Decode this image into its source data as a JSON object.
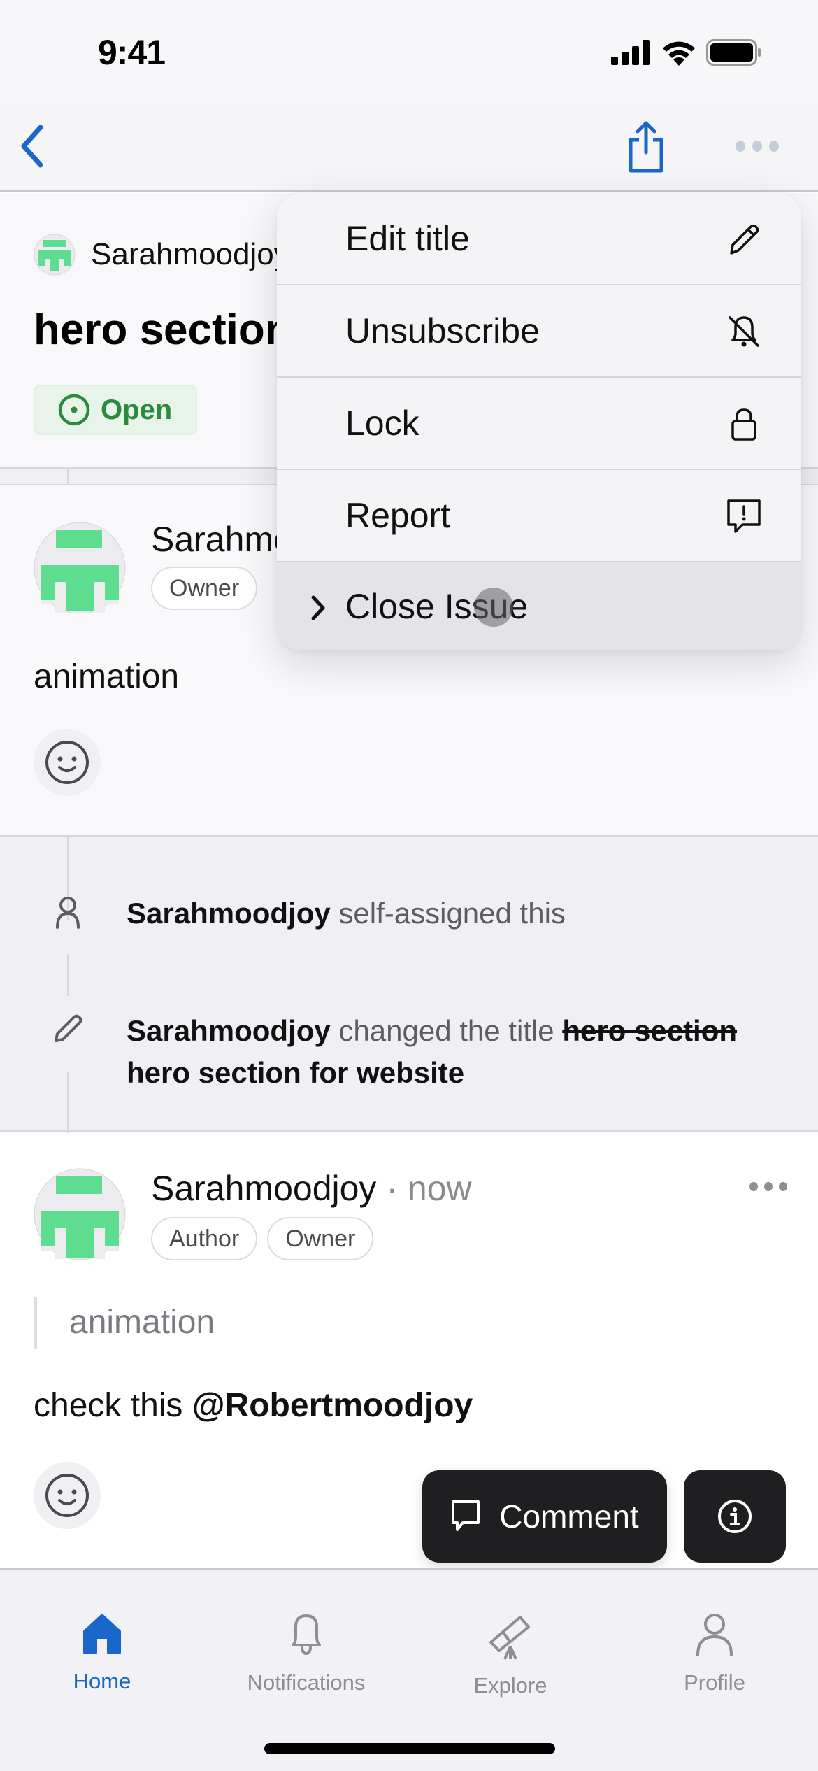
{
  "status_bar": {
    "time": "9:41"
  },
  "nav": {
    "back_icon": "chevron-left-icon",
    "share_icon": "share-icon",
    "more_icon": "ellipsis-icon",
    "accent_color": "#1a66c9"
  },
  "issue": {
    "author": "Sarahmoodjoy",
    "title": "hero section for website",
    "state": "Open",
    "state_color": "#2a8a3d"
  },
  "comments": [
    {
      "author": "Sarahmoodjoy",
      "badges": [
        "Owner"
      ],
      "body": "animation"
    },
    {
      "author": "Sarahmoodjoy",
      "separator": "·",
      "time": "now",
      "badges": [
        "Author",
        "Owner"
      ],
      "quote": "animation",
      "body_prefix": "check this ",
      "mention": "@Robertmoodjoy"
    }
  ],
  "events": [
    {
      "icon": "person-icon",
      "actor": "Sarahmoodjoy",
      "action": "self-assigned this"
    },
    {
      "icon": "pencil-icon",
      "actor": "Sarahmoodjoy",
      "action": "changed the title",
      "old_title": "hero section",
      "new_title": "hero section for website"
    }
  ],
  "menu": {
    "items": [
      {
        "label": "Edit title",
        "icon": "pencil-icon"
      },
      {
        "label": "Unsubscribe",
        "icon": "bell-slash-icon"
      },
      {
        "label": "Lock",
        "icon": "lock-icon"
      },
      {
        "label": "Report",
        "icon": "report-icon"
      },
      {
        "label": "Close Issue",
        "icon": "chevron-right-icon",
        "highlighted": true
      }
    ]
  },
  "actions": {
    "comment_label": "Comment",
    "info_icon": "info-icon"
  },
  "tabs": [
    {
      "label": "Home",
      "icon": "home-icon",
      "active": true
    },
    {
      "label": "Notifications",
      "icon": "bell-icon",
      "active": false
    },
    {
      "label": "Explore",
      "icon": "telescope-icon",
      "active": false
    },
    {
      "label": "Profile",
      "icon": "person-icon",
      "active": false
    }
  ]
}
